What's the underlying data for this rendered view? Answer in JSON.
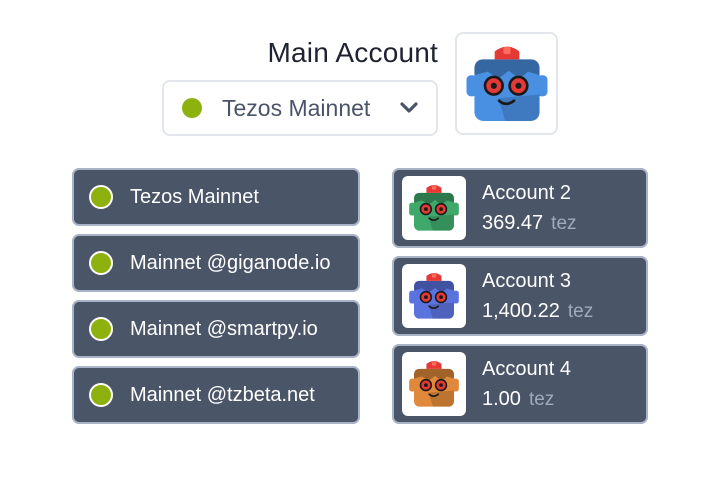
{
  "header": {
    "account_name": "Main Account",
    "selected_network": "Tezos Mainnet",
    "status_color": "#8db10e",
    "avatar": {
      "icon": "robot-avatar-icon",
      "color": "#4a90e2"
    }
  },
  "networks": [
    {
      "label": "Tezos Mainnet"
    },
    {
      "label": "Mainnet @giganode.io"
    },
    {
      "label": "Mainnet @smartpy.io"
    },
    {
      "label": "Mainnet @tzbeta.net"
    }
  ],
  "accounts": [
    {
      "name": "Account 2",
      "balance": "369.47",
      "unit": "tez",
      "avatar_color": "#3fa86b"
    },
    {
      "name": "Account 3",
      "balance": "1,400.22",
      "unit": "tez",
      "avatar_color": "#5b73de"
    },
    {
      "name": "Account 4",
      "balance": "1.00",
      "unit": "tez",
      "avatar_color": "#e0893a"
    }
  ]
}
